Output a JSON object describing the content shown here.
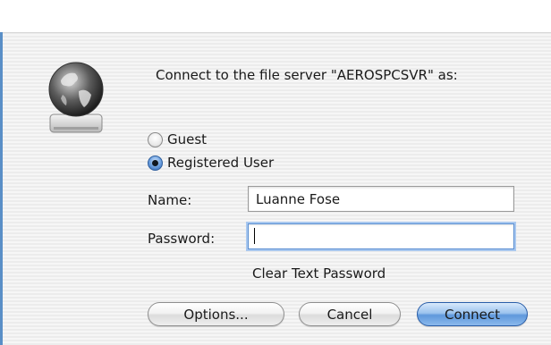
{
  "dialog": {
    "prompt": "Connect to the file server \"AEROSPCSVR\" as:"
  },
  "auth": {
    "guest_label": "Guest",
    "registered_label": "Registered User",
    "selected": "Registered User"
  },
  "fields": {
    "name_label": "Name:",
    "name_value": "Luanne Fose",
    "password_label": "Password:",
    "password_value": ""
  },
  "security_note": "Clear Text Password",
  "buttons": {
    "options": "Options...",
    "cancel": "Cancel",
    "connect": "Connect"
  },
  "icons": {
    "server": "globe-server-icon"
  },
  "colors": {
    "default_button": "#5f98dc",
    "focus_ring": "#a9c8ef"
  }
}
